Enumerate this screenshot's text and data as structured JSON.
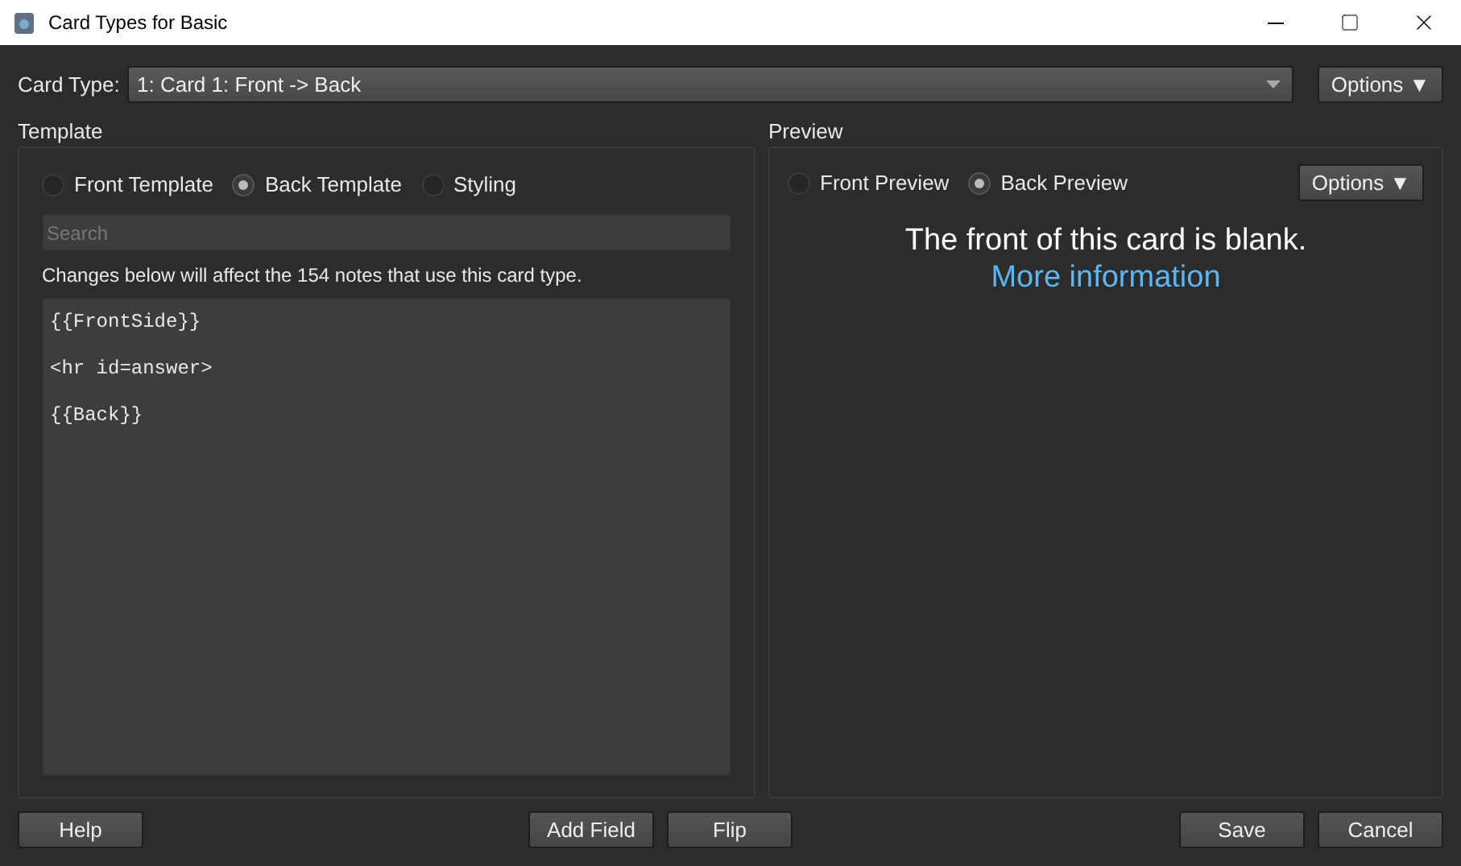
{
  "window": {
    "title": "Card Types for Basic"
  },
  "card_type": {
    "label": "Card Type:",
    "value": "1: Card 1: Front -> Back",
    "options_button": "Options ▼"
  },
  "template": {
    "title": "Template",
    "tabs": [
      {
        "label": "Front Template",
        "selected": false
      },
      {
        "label": "Back Template",
        "selected": true
      },
      {
        "label": "Styling",
        "selected": false
      }
    ],
    "search": {
      "placeholder": "Search"
    },
    "notice": "Changes below will affect the 154 notes that use this card type.",
    "editor_lines": [
      "{{FrontSide}}",
      "<hr id=answer>",
      "{{Back}}"
    ]
  },
  "preview": {
    "title": "Preview",
    "tabs": [
      {
        "label": "Front Preview",
        "selected": false
      },
      {
        "label": "Back Preview",
        "selected": true
      }
    ],
    "options_button": "Options ▼",
    "message": "The front of this card is blank.",
    "link": "More information"
  },
  "buttons": {
    "left": [
      "Help"
    ],
    "center": [
      "Add Field",
      "Flip"
    ],
    "right": [
      "Save",
      "Cancel"
    ]
  }
}
